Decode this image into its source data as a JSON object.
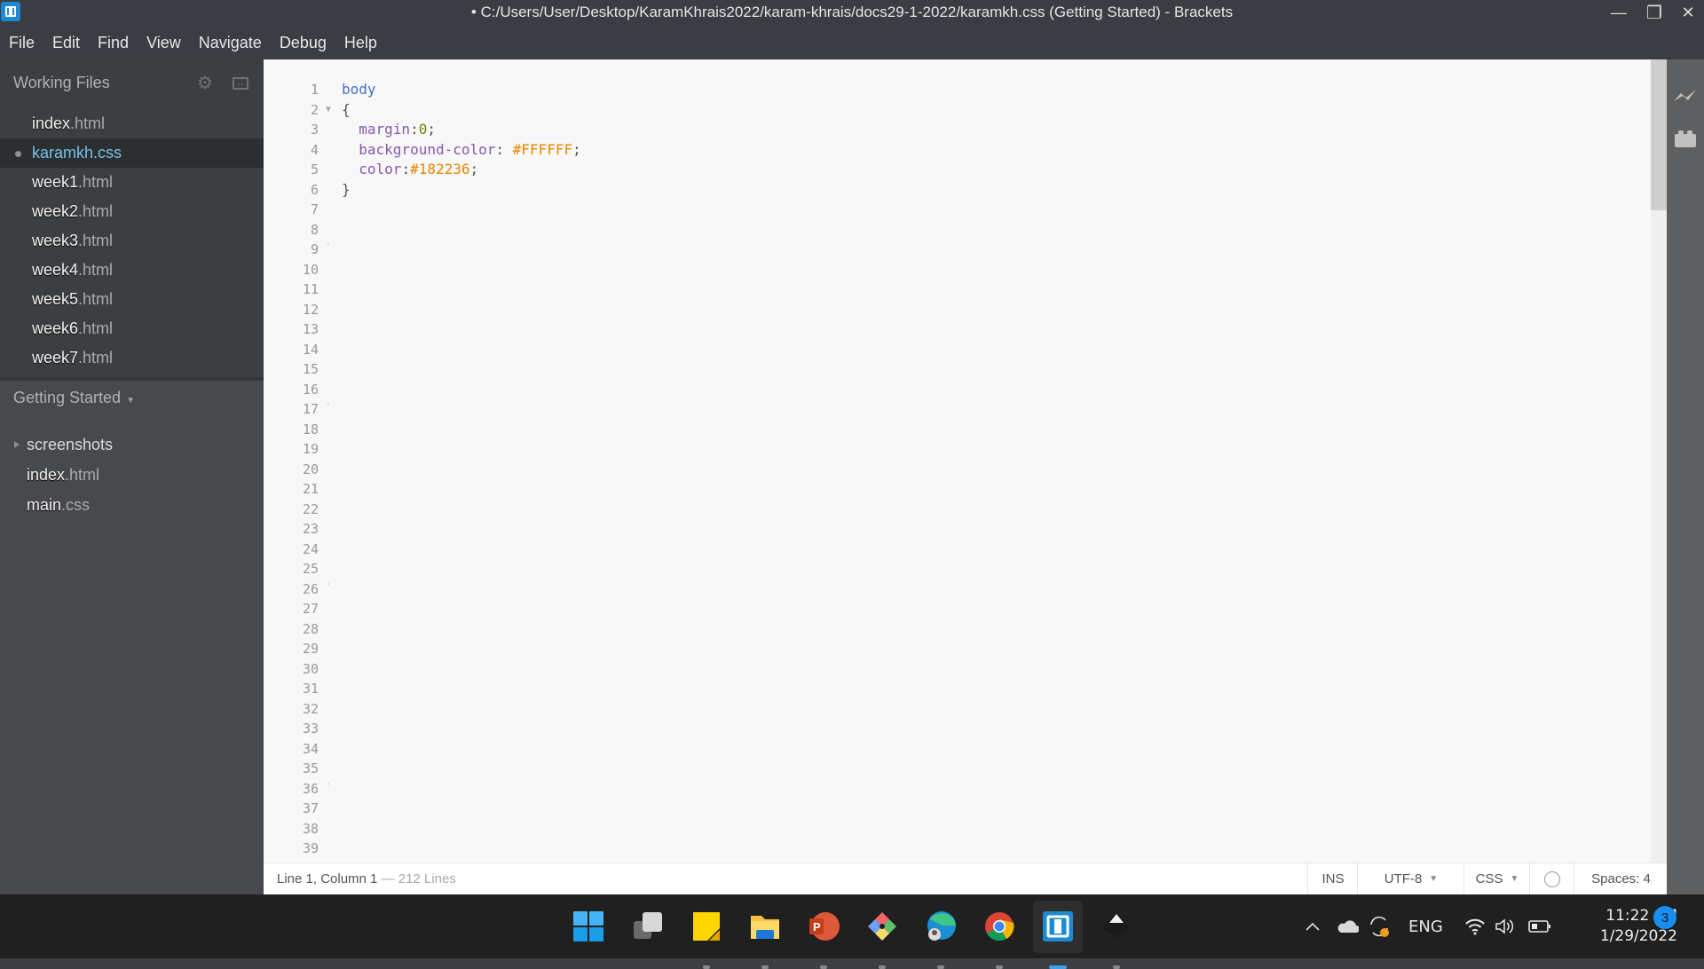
{
  "window": {
    "title": "• C:/Users/User/Desktop/KaramKhrais2022/karam-khrais/docs29-1-2022/karamkh.css (Getting Started) - Brackets",
    "controls": {
      "minimize": "—",
      "restore": "❐",
      "close": "✕"
    }
  },
  "menubar": [
    "File",
    "Edit",
    "Find",
    "View",
    "Navigate",
    "Debug",
    "Help"
  ],
  "sidebar": {
    "working_files_label": "Working Files",
    "working_files": [
      {
        "name": "index",
        "ext": ".html",
        "active": false
      },
      {
        "name": "karamkh.css",
        "ext": "",
        "active": true,
        "dirty": true
      },
      {
        "name": "week1",
        "ext": ".html",
        "active": false
      },
      {
        "name": "week2",
        "ext": ".html",
        "active": false
      },
      {
        "name": "week3",
        "ext": ".html",
        "active": false
      },
      {
        "name": "week4",
        "ext": ".html",
        "active": false
      },
      {
        "name": "week5",
        "ext": ".html",
        "active": false
      },
      {
        "name": "week6",
        "ext": ".html",
        "active": false
      },
      {
        "name": "week7",
        "ext": ".html",
        "active": false
      }
    ],
    "project_label": "Getting Started",
    "project_tree": [
      {
        "name": "screenshots",
        "ext": "",
        "type": "folder"
      },
      {
        "name": "index",
        "ext": ".html",
        "type": "file"
      },
      {
        "name": "main",
        "ext": ".css",
        "type": "file"
      }
    ]
  },
  "editor": {
    "visible_line_count": 39,
    "fold_lines": [
      2
    ],
    "marker_lines": [
      9,
      17,
      26,
      36
    ],
    "code": [
      [
        {
          "t": "tag",
          "v": "body"
        }
      ],
      [
        {
          "t": "punc",
          "v": "{"
        }
      ],
      [
        {
          "t": "punc",
          "v": "  "
        },
        {
          "t": "prop",
          "v": "margin"
        },
        {
          "t": "punc",
          "v": ":"
        },
        {
          "t": "num",
          "v": "0"
        },
        {
          "t": "punc",
          "v": ";"
        }
      ],
      [
        {
          "t": "punc",
          "v": "  "
        },
        {
          "t": "prop",
          "v": "background-color"
        },
        {
          "t": "punc",
          "v": ": "
        },
        {
          "t": "hex",
          "v": "#FFFFFF"
        },
        {
          "t": "punc",
          "v": ";"
        }
      ],
      [
        {
          "t": "punc",
          "v": "  "
        },
        {
          "t": "prop",
          "v": "color"
        },
        {
          "t": "punc",
          "v": ":"
        },
        {
          "t": "hex",
          "v": "#182236"
        },
        {
          "t": "punc",
          "v": ";"
        }
      ],
      [
        {
          "t": "punc",
          "v": "}"
        }
      ]
    ]
  },
  "statusbar": {
    "cursor": "Line 1, Column 1",
    "lines": " — 212 Lines",
    "mode": "INS",
    "encoding": "UTF-8",
    "language": "CSS",
    "spaces": "Spaces:  4"
  },
  "taskbar": {
    "apps": [
      "start",
      "task-view",
      "sticky-notes",
      "file-explorer",
      "powerpoint",
      "git",
      "edge",
      "chrome",
      "brackets",
      "inkscape"
    ],
    "active_app": "brackets",
    "tray": {
      "language": "ENG",
      "time": "11:22 AM",
      "date": "1/29/2022",
      "notifications": "3"
    }
  }
}
